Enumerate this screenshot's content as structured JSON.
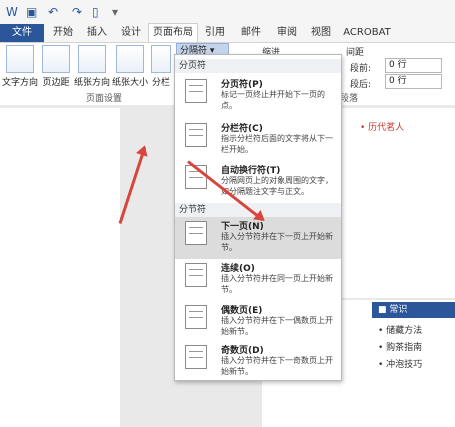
{
  "tabs": [
    "文件",
    "开始",
    "插入",
    "设计",
    "页面布局",
    "引用",
    "邮件",
    "审阅",
    "视图",
    "ACROBAT"
  ],
  "ribbon": {
    "buttons": [
      "文字方向",
      "页边距",
      "纸张方向",
      "纸张大小",
      "分栏"
    ],
    "group_label": "页面设置",
    "breaks_button": "分隔符",
    "indent_label": "缩进",
    "spacing_label": "间距",
    "before_label": "段前:",
    "before_value": "0 行",
    "after_label": "段后:",
    "after_value": "0 行",
    "paragraph_label": "段落"
  },
  "menu": {
    "page_breaks_header": "分页符",
    "section_breaks_header": "分节符",
    "items": [
      {
        "title": "分页符(P)",
        "desc": "标记一页终止并开始下一页的点。"
      },
      {
        "title": "分栏符(C)",
        "desc": "指示分栏符后面的文字将从下一栏开始。"
      },
      {
        "title": "自动换行符(T)",
        "desc": "分隔网页上的对象周围的文字，如分隔题注文字与正文。"
      },
      {
        "title": "下一页(N)",
        "desc": "插入分节符并在下一页上开始新节。"
      },
      {
        "title": "连续(O)",
        "desc": "插入分节符并在同一页上开始新节。"
      },
      {
        "title": "偶数页(E)",
        "desc": "插入分节符并在下一偶数页上开始新节。"
      },
      {
        "title": "奇数页(D)",
        "desc": "插入分节符并在下一奇数页上开始新节。"
      }
    ]
  },
  "doc": {
    "sidebar_tag": "历代茗人",
    "know_header": "常识",
    "know_items": [
      "储藏方法",
      "购茶指南",
      "冲泡技巧"
    ]
  },
  "colors": {
    "accent": "#2b579a",
    "arrow": "#d7453c"
  }
}
